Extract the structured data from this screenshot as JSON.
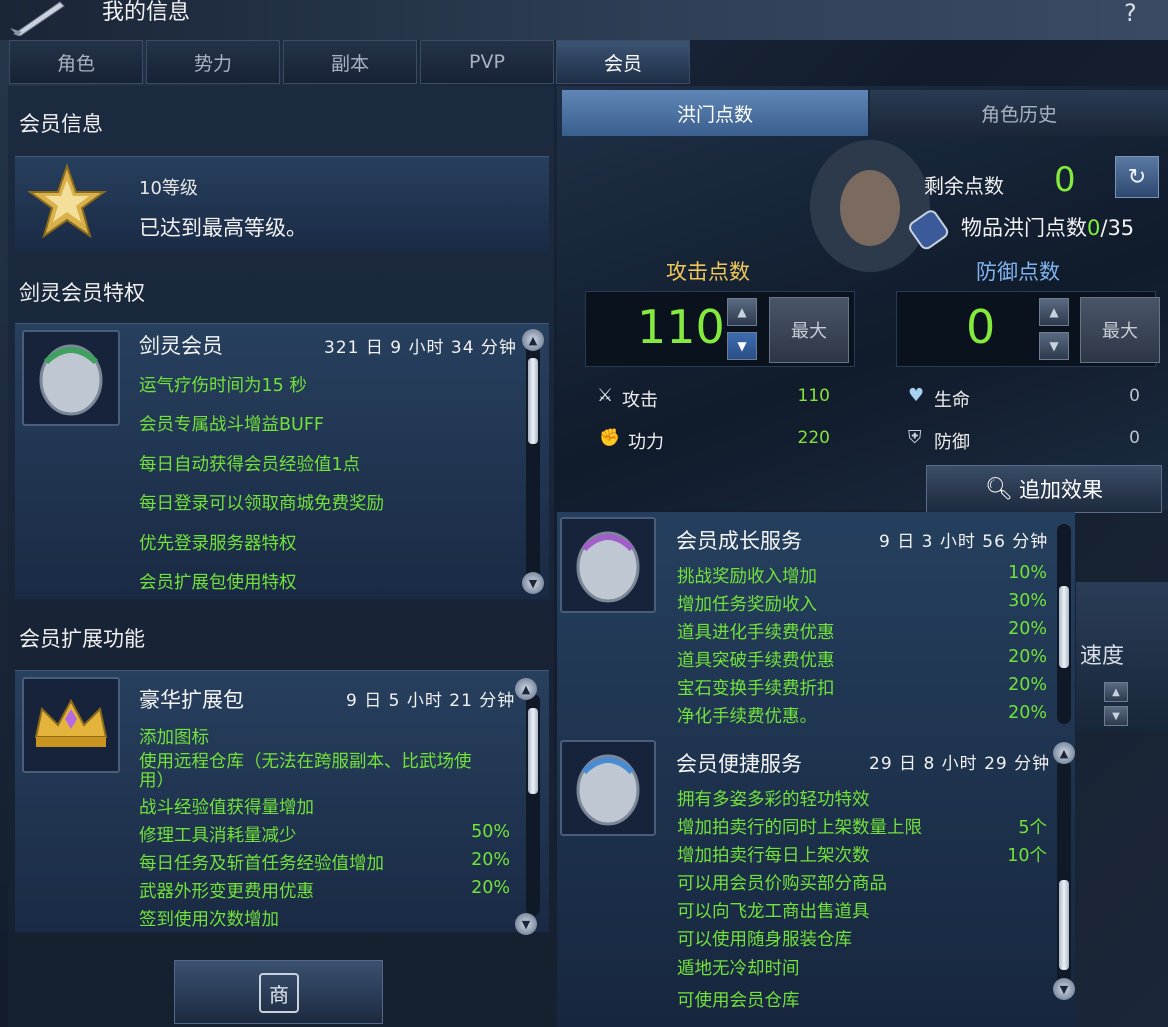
{
  "window": {
    "title": "我的信息",
    "help": "?"
  },
  "tabs": [
    "角色",
    "势力",
    "副本",
    "PVP",
    "会员"
  ],
  "active_tab": "会员",
  "member_info": {
    "heading": "会员信息",
    "level": "10等级",
    "status": "已达到最高等级。"
  },
  "privileges": {
    "heading": "剑灵会员特权",
    "title": "剑灵会员",
    "timer": "321 日 9 小时 34 分钟",
    "lines": [
      "运气疗伤时间为15 秒",
      "会员专属战斗增益BUFF",
      "每日自动获得会员经验值1点",
      "每日登录可以领取商城免费奖励",
      "优先登录服务器特权",
      "会员扩展包使用特权"
    ]
  },
  "extension": {
    "heading": "会员扩展功能",
    "title": "豪华扩展包",
    "timer": "9 日 5 小时 21 分钟",
    "lines": [
      {
        "text": "添加图标",
        "value": ""
      },
      {
        "text": "使用远程仓库（无法在跨服副本、比武场使",
        "value": ""
      },
      {
        "text": "用）",
        "value": ""
      },
      {
        "text": "战斗经验值获得量增加",
        "value": ""
      },
      {
        "text": "修理工具消耗量减少",
        "value": "50%"
      },
      {
        "text": "每日任务及斩首任务经验值增加",
        "value": "20%"
      },
      {
        "text": "武器外形变更费用优惠",
        "value": "20%"
      },
      {
        "text": "签到使用次数增加",
        "value": ""
      }
    ]
  },
  "hongmen": {
    "tab_points": "洪门点数",
    "tab_history": "角色历史",
    "remaining_label": "剩余点数",
    "remaining_value": "0",
    "item_points_label": "物品洪门点数",
    "item_points_current": "0",
    "item_points_total": "/35",
    "attack_label": "攻击点数",
    "defense_label": "防御点数",
    "attack_value": "110",
    "defense_value": "0",
    "max_label": "最大",
    "stats": [
      {
        "label": "攻击",
        "value": "110"
      },
      {
        "label": "功力",
        "value": "220"
      },
      {
        "label": "生命",
        "value": "0"
      },
      {
        "label": "防御",
        "value": "0"
      }
    ],
    "effect_button": "追加效果",
    "side_text": "速度"
  },
  "growth": {
    "title": "会员成长服务",
    "timer": "9 日 3 小时 56 分钟",
    "lines": [
      {
        "text": "挑战奖励收入增加",
        "value": "10%"
      },
      {
        "text": "增加任务奖励收入",
        "value": "30%"
      },
      {
        "text": "道具进化手续费优惠",
        "value": "20%"
      },
      {
        "text": "道具突破手续费优惠",
        "value": "20%"
      },
      {
        "text": "宝石变换手续费折扣",
        "value": "20%"
      },
      {
        "text": "净化手续费优惠。",
        "value": "20%"
      }
    ]
  },
  "convenience": {
    "title": "会员便捷服务",
    "timer": "29 日 8 小时 29 分钟",
    "lines": [
      {
        "text": "拥有多姿多彩的轻功特效",
        "value": ""
      },
      {
        "text": "增加拍卖行的同时上架数量上限",
        "value": "5个"
      },
      {
        "text": "增加拍卖行每日上架次数",
        "value": "10个"
      },
      {
        "text": "可以用会员价购买部分商品",
        "value": ""
      },
      {
        "text": "可以向飞龙工商出售道具",
        "value": ""
      },
      {
        "text": "可以使用随身服装仓库",
        "value": ""
      },
      {
        "text": "遁地无冷却时间",
        "value": ""
      },
      {
        "text": "可使用会员仓库",
        "value": ""
      }
    ]
  },
  "shop_button": "商"
}
